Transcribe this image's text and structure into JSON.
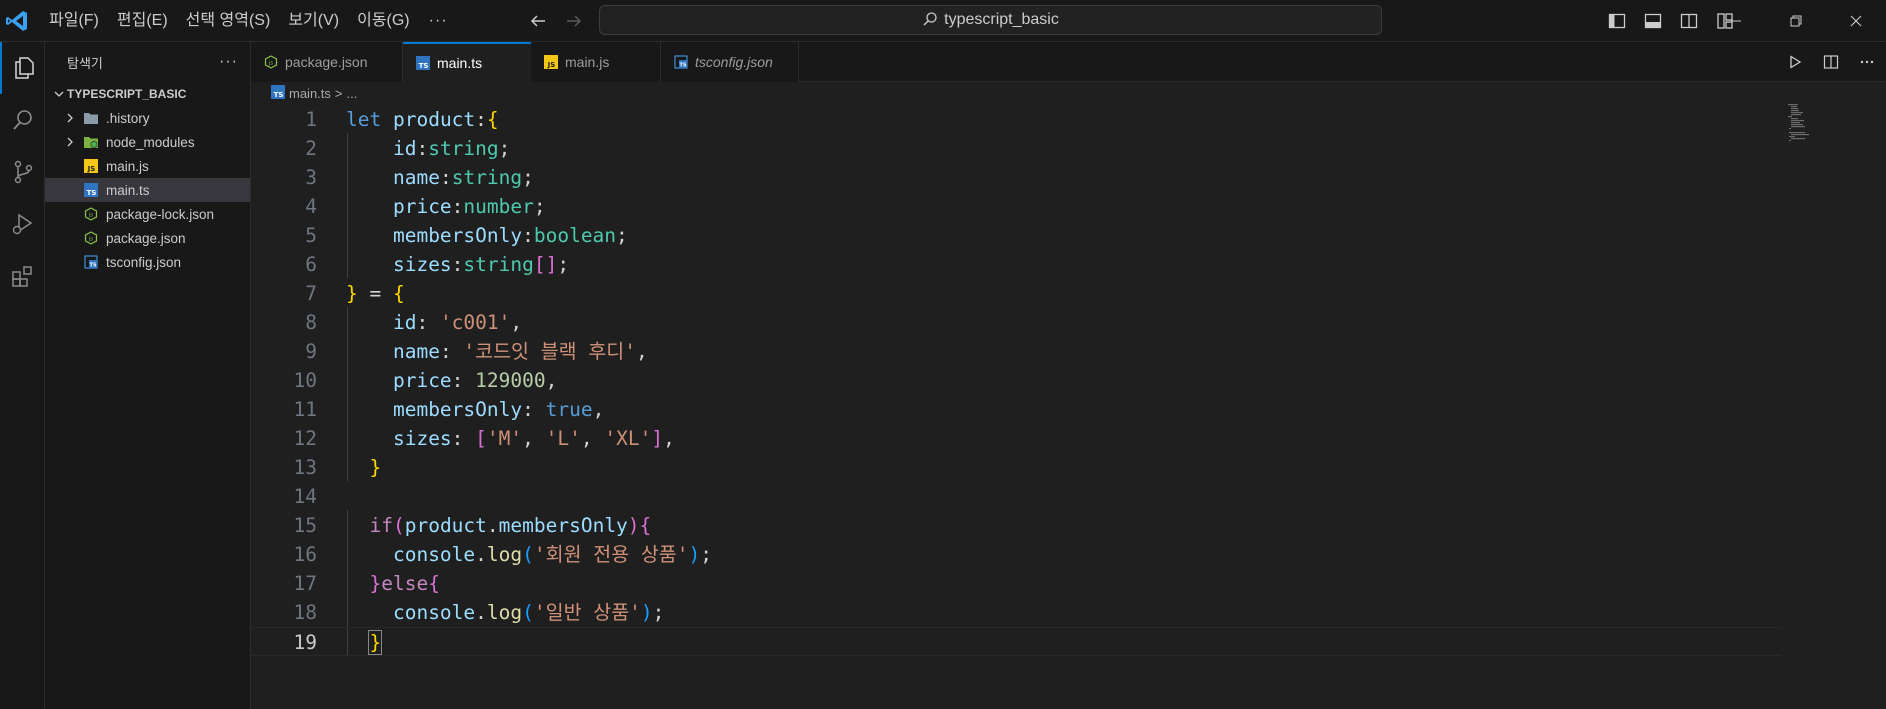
{
  "titlebar": {
    "menu": [
      "파일(F)",
      "편집(E)",
      "선택 영역(S)",
      "보기(V)",
      "이동(G)"
    ],
    "more": "···",
    "search_text": "typescript_basic"
  },
  "sidebar": {
    "title": "탐색기",
    "more": "···",
    "folder": "TYPESCRIPT_BASIC",
    "items": [
      {
        "label": ".history",
        "kind": "folder"
      },
      {
        "label": "node_modules",
        "kind": "folder"
      },
      {
        "label": "main.js",
        "kind": "js"
      },
      {
        "label": "main.ts",
        "kind": "ts",
        "selected": true
      },
      {
        "label": "package-lock.json",
        "kind": "json"
      },
      {
        "label": "package.json",
        "kind": "json"
      },
      {
        "label": "tsconfig.json",
        "kind": "tsconfig"
      }
    ]
  },
  "tabs": [
    {
      "label": "package.json",
      "kind": "json"
    },
    {
      "label": "main.ts",
      "kind": "ts",
      "active": true
    },
    {
      "label": "main.js",
      "kind": "js"
    },
    {
      "label": "tsconfig.json",
      "kind": "tsconfig",
      "italic": true
    }
  ],
  "breadcrumb": {
    "file": "main.ts",
    "sep": ">",
    "rest": "..."
  },
  "editor": {
    "line_numbers": [
      "1",
      "2",
      "3",
      "4",
      "5",
      "6",
      "7",
      "8",
      "9",
      "10",
      "11",
      "12",
      "13",
      "14",
      "15",
      "16",
      "17",
      "18",
      "19"
    ],
    "lines": [
      [
        [
          "kw",
          "let"
        ],
        [
          "pl",
          " "
        ],
        [
          "var",
          "product"
        ],
        [
          "pl",
          ":"
        ],
        [
          "b1",
          "{"
        ]
      ],
      [
        [
          "pl",
          "    "
        ],
        [
          "var",
          "id"
        ],
        [
          "pl",
          ":"
        ],
        [
          "type",
          "string"
        ],
        [
          "pl",
          ";"
        ]
      ],
      [
        [
          "pl",
          "    "
        ],
        [
          "var",
          "name"
        ],
        [
          "pl",
          ":"
        ],
        [
          "type",
          "string"
        ],
        [
          "pl",
          ";"
        ]
      ],
      [
        [
          "pl",
          "    "
        ],
        [
          "var",
          "price"
        ],
        [
          "pl",
          ":"
        ],
        [
          "type",
          "number"
        ],
        [
          "pl",
          ";"
        ]
      ],
      [
        [
          "pl",
          "    "
        ],
        [
          "var",
          "membersOnly"
        ],
        [
          "pl",
          ":"
        ],
        [
          "type",
          "boolean"
        ],
        [
          "pl",
          ";"
        ]
      ],
      [
        [
          "pl",
          "    "
        ],
        [
          "var",
          "sizes"
        ],
        [
          "pl",
          ":"
        ],
        [
          "type",
          "string"
        ],
        [
          "b2",
          "[]"
        ],
        [
          "pl",
          ";"
        ]
      ],
      [
        [
          "b1",
          "}"
        ],
        [
          "pl",
          " = "
        ],
        [
          "b1",
          "{"
        ]
      ],
      [
        [
          "pl",
          "    "
        ],
        [
          "var",
          "id"
        ],
        [
          "pl",
          ": "
        ],
        [
          "str",
          "'c001'"
        ],
        [
          "pl",
          ","
        ]
      ],
      [
        [
          "pl",
          "    "
        ],
        [
          "var",
          "name"
        ],
        [
          "pl",
          ": "
        ],
        [
          "str",
          "'코드잇 블랙 후디'"
        ],
        [
          "pl",
          ","
        ]
      ],
      [
        [
          "pl",
          "    "
        ],
        [
          "var",
          "price"
        ],
        [
          "pl",
          ": "
        ],
        [
          "num",
          "129000"
        ],
        [
          "pl",
          ","
        ]
      ],
      [
        [
          "pl",
          "    "
        ],
        [
          "var",
          "membersOnly"
        ],
        [
          "pl",
          ": "
        ],
        [
          "kw",
          "true"
        ],
        [
          "pl",
          ","
        ]
      ],
      [
        [
          "pl",
          "    "
        ],
        [
          "var",
          "sizes"
        ],
        [
          "pl",
          ": "
        ],
        [
          "b2",
          "["
        ],
        [
          "str",
          "'M'"
        ],
        [
          "pl",
          ", "
        ],
        [
          "str",
          "'L'"
        ],
        [
          "pl",
          ", "
        ],
        [
          "str",
          "'XL'"
        ],
        [
          "b2",
          "]"
        ],
        [
          "pl",
          ","
        ]
      ],
      [
        [
          "pl",
          "  "
        ],
        [
          "b1",
          "}"
        ]
      ],
      [
        [
          "pl",
          ""
        ]
      ],
      [
        [
          "pl",
          "  "
        ],
        [
          "kwc",
          "if"
        ],
        [
          "b2",
          "("
        ],
        [
          "var",
          "product"
        ],
        [
          "pl",
          "."
        ],
        [
          "var",
          "membersOnly"
        ],
        [
          "b2",
          ")"
        ],
        [
          "b2",
          "{"
        ]
      ],
      [
        [
          "pl",
          "    "
        ],
        [
          "var",
          "console"
        ],
        [
          "pl",
          "."
        ],
        [
          "fn",
          "log"
        ],
        [
          "b3",
          "("
        ],
        [
          "str",
          "'회원 전용 상품'"
        ],
        [
          "b3",
          ")"
        ],
        [
          "pl",
          ";"
        ]
      ],
      [
        [
          "pl",
          "  "
        ],
        [
          "b2",
          "}"
        ],
        [
          "kwc",
          "else"
        ],
        [
          "b2",
          "{"
        ]
      ],
      [
        [
          "pl",
          "    "
        ],
        [
          "var",
          "console"
        ],
        [
          "pl",
          "."
        ],
        [
          "fn",
          "log"
        ],
        [
          "b3",
          "("
        ],
        [
          "str",
          "'일반 상품'"
        ],
        [
          "b3",
          ")"
        ],
        [
          "pl",
          ";"
        ]
      ],
      [
        [
          "pl",
          "  "
        ],
        [
          "b1",
          "}"
        ]
      ]
    ],
    "current_line": 19
  }
}
